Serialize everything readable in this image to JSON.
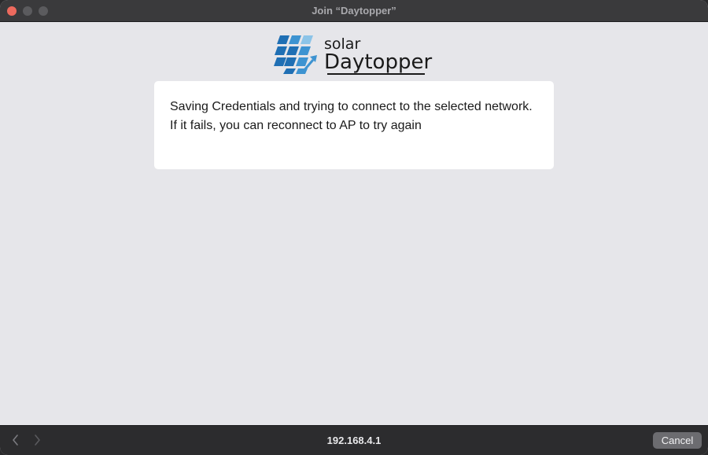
{
  "window": {
    "title": "Join “Daytopper”"
  },
  "logo": {
    "line1": "solar",
    "line2": "Daytopper",
    "colors": {
      "dark_blue": "#1f6fb4",
      "mid_blue": "#3d93d1",
      "light_blue": "#8cc4e8",
      "text": "#1a1a1a"
    }
  },
  "message": {
    "line1": "Saving Credentials and trying to connect to the selected network.",
    "line2": "If it fails, you can reconnect to AP to try again"
  },
  "toolbar": {
    "back_icon": "chevron-left-icon",
    "forward_icon": "chevron-right-icon",
    "address": "192.168.4.1",
    "cancel_label": "Cancel"
  }
}
